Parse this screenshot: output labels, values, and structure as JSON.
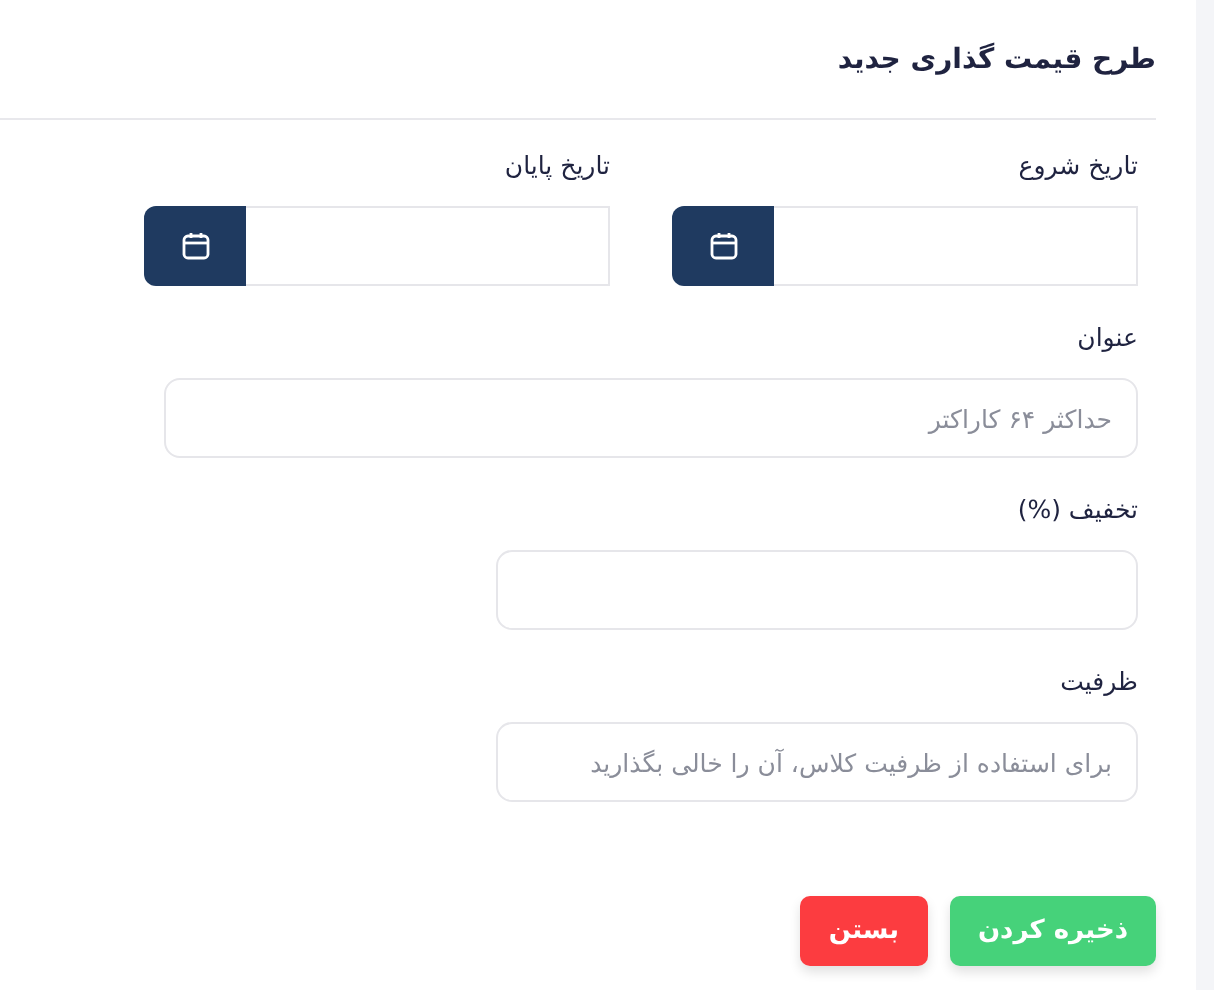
{
  "dialog": {
    "title": "طرح قیمت گذاری جدید",
    "fields": [
      {
        "kind": "date",
        "label": "تاریخ شروع"
      },
      {
        "kind": "date",
        "label": "تاریخ پایان"
      },
      {
        "kind": "wide",
        "label": "عنوان",
        "placeholder": "حداکثر ۶۴ کاراکتر"
      },
      {
        "kind": "narrow",
        "label": "تخفیف (%)"
      },
      {
        "kind": "narrow",
        "label": "ظرفیت",
        "placeholder": "برای استفاده از ظرفیت کلاس، آن را خالی بگذارید"
      }
    ],
    "buttons": [
      {
        "kind": "primary",
        "label": "ذخیره کردن"
      },
      {
        "kind": "danger",
        "label": "بستن"
      }
    ]
  }
}
